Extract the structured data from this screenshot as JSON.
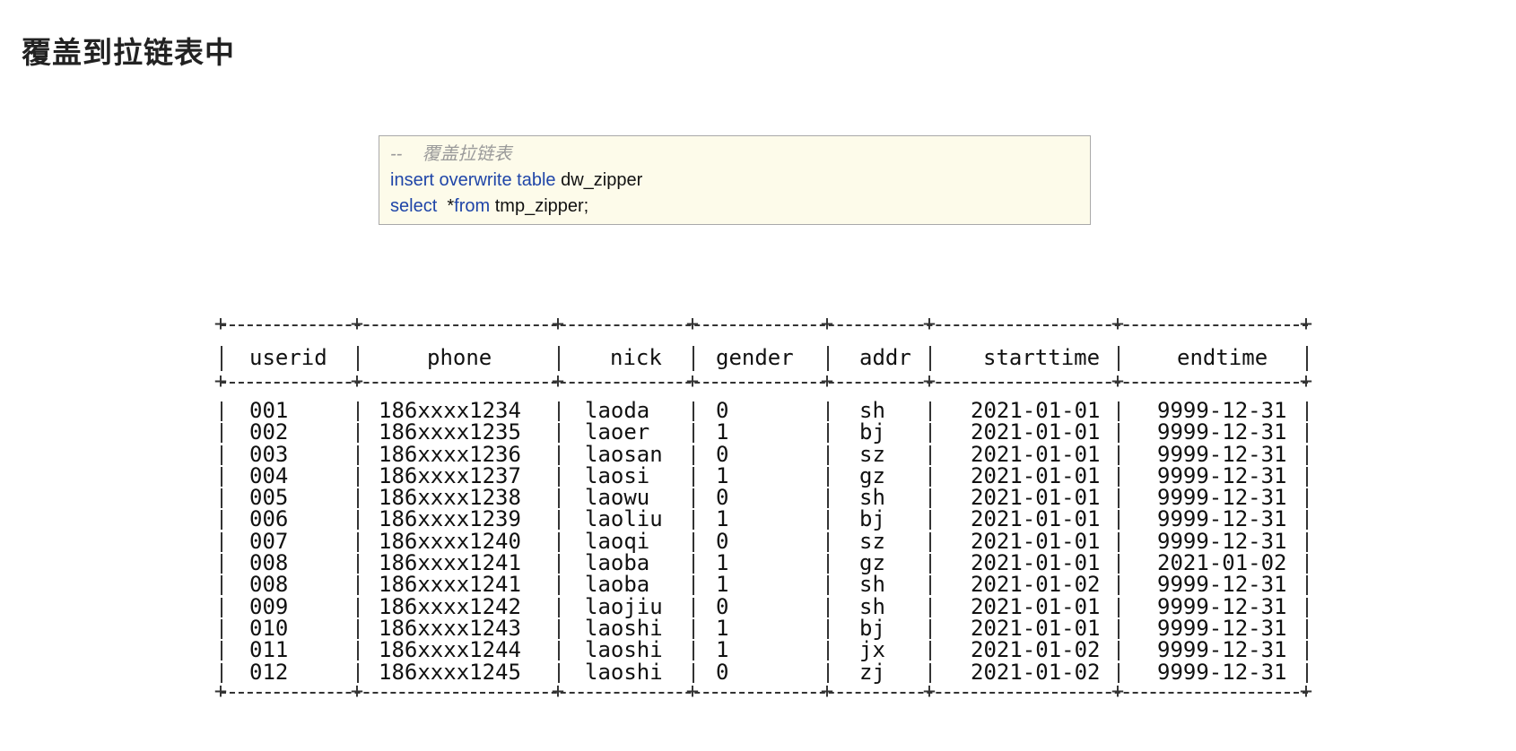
{
  "page": {
    "title": "覆盖到拉链表中"
  },
  "code": {
    "comment_prefix": "--",
    "comment_text": "覆盖拉链表",
    "line2_kw": "insert overwrite table",
    "line2_ident": "dw_zipper",
    "line3_kw1": "select",
    "line3_star": "*",
    "line3_kw2": "from",
    "line3_ident": "tmp_zipper;"
  },
  "table": {
    "columns": [
      "userid",
      "phone",
      "nick",
      "gender",
      "addr",
      "starttime",
      "endtime"
    ],
    "rows": [
      [
        "001",
        "186xxxx1234",
        "laoda",
        "0",
        "sh",
        "2021-01-01",
        "9999-12-31"
      ],
      [
        "002",
        "186xxxx1235",
        "laoer",
        "1",
        "bj",
        "2021-01-01",
        "9999-12-31"
      ],
      [
        "003",
        "186xxxx1236",
        "laosan",
        "0",
        "sz",
        "2021-01-01",
        "9999-12-31"
      ],
      [
        "004",
        "186xxxx1237",
        "laosi",
        "1",
        "gz",
        "2021-01-01",
        "9999-12-31"
      ],
      [
        "005",
        "186xxxx1238",
        "laowu",
        "0",
        "sh",
        "2021-01-01",
        "9999-12-31"
      ],
      [
        "006",
        "186xxxx1239",
        "laoliu",
        "1",
        "bj",
        "2021-01-01",
        "9999-12-31"
      ],
      [
        "007",
        "186xxxx1240",
        "laoqi",
        "0",
        "sz",
        "2021-01-01",
        "9999-12-31"
      ],
      [
        "008",
        "186xxxx1241",
        "laoba",
        "1",
        "gz",
        "2021-01-01",
        "2021-01-02"
      ],
      [
        "008",
        "186xxxx1241",
        "laoba",
        "1",
        "sh",
        "2021-01-02",
        "9999-12-31"
      ],
      [
        "009",
        "186xxxx1242",
        "laojiu",
        "0",
        "sh",
        "2021-01-01",
        "9999-12-31"
      ],
      [
        "010",
        "186xxxx1243",
        "laoshi",
        "1",
        "bj",
        "2021-01-01",
        "9999-12-31"
      ],
      [
        "011",
        "186xxxx1244",
        "laoshi",
        "1",
        "jx",
        "2021-01-02",
        "9999-12-31"
      ],
      [
        "012",
        "186xxxx1245",
        "laoshi",
        "0",
        "zj",
        "2021-01-02",
        "9999-12-31"
      ]
    ]
  }
}
